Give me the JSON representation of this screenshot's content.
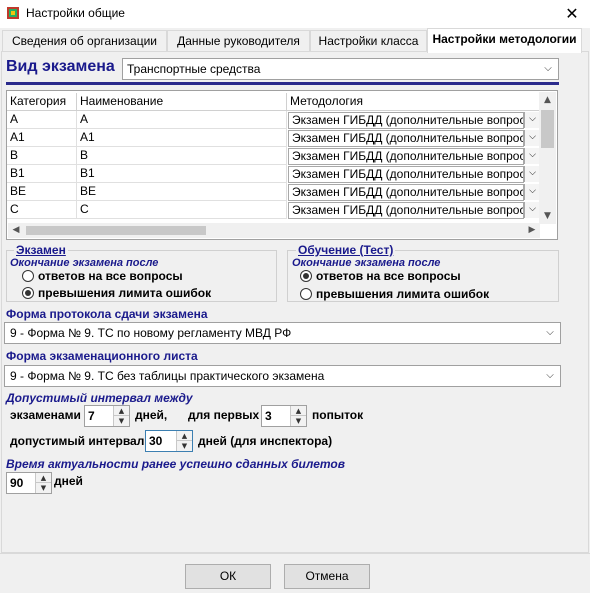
{
  "window": {
    "title": "Настройки общие",
    "close_glyph": "✕"
  },
  "tabs": [
    {
      "label": "Сведения об организации"
    },
    {
      "label": "Данные руководителя"
    },
    {
      "label": "Настройки класса"
    },
    {
      "label": "Настройки методологии",
      "active": true
    }
  ],
  "exam_type": {
    "label": "Вид экзамена",
    "value": "Транспортные средства"
  },
  "grid": {
    "columns": [
      "Категория",
      "Наименование",
      "Методология"
    ],
    "rows": [
      {
        "category": "A",
        "name": "A",
        "method": "Экзамен ГИБДД (дополнительные вопросы)"
      },
      {
        "category": "A1",
        "name": "A1",
        "method": "Экзамен ГИБДД (дополнительные вопросы)"
      },
      {
        "category": "B",
        "name": "B",
        "method": "Экзамен ГИБДД (дополнительные вопросы)"
      },
      {
        "category": "B1",
        "name": "B1",
        "method": "Экзамен ГИБДД (дополнительные вопросы)"
      },
      {
        "category": "BE",
        "name": "BE",
        "method": "Экзамен ГИБДД (дополнительные вопросы)"
      },
      {
        "category": "C",
        "name": "C",
        "method": "Экзамен ГИБДД (дополнительные вопросы)"
      }
    ]
  },
  "exam_group": {
    "title": "Экзамен",
    "subtitle": "Окончание экзамена после",
    "options": [
      {
        "label": "ответов на все вопросы",
        "checked": false
      },
      {
        "label": "превышения лимита ошибок",
        "checked": true
      }
    ]
  },
  "training_group": {
    "title": "Обучение (Тест)",
    "subtitle": "Окончание экзамена после",
    "options": [
      {
        "label": "ответов на все вопросы",
        "checked": true
      },
      {
        "label": "превышения лимита ошибок",
        "checked": false
      }
    ]
  },
  "protocol": {
    "label": "Форма протокола сдачи экзамена",
    "value": "9 - Форма № 9. ТС по новому регламенту МВД РФ"
  },
  "exam_sheet": {
    "label": "Форма экзаменационного листа",
    "value": "9 - Форма № 9. ТС без таблицы практического экзамена"
  },
  "interval": {
    "label": "Допустимый интервал между",
    "exams_label": "экзаменами",
    "exams_value": "7",
    "days_label": "дней,",
    "first_label": "для первых",
    "first_value": "3",
    "attempts_label": "попыток",
    "allowed_label": "допустимый интервал",
    "allowed_value": "30",
    "inspector_label": "дней (для инспектора)"
  },
  "relevance": {
    "label": "Время актуальности ранее успешно сданных билетов",
    "value": "90",
    "days_label": "дней"
  },
  "buttons": {
    "ok": "ОК",
    "cancel": "Отмена"
  },
  "colors": {
    "accent": "#1a1a8c",
    "panel": "#f0f0f0"
  }
}
